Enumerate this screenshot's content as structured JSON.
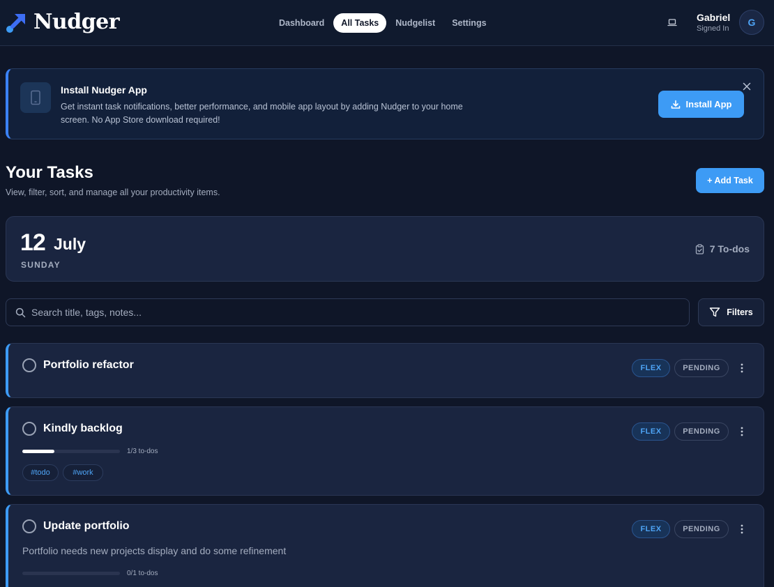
{
  "app": {
    "name": "Nudger"
  },
  "nav": [
    "Dashboard",
    "All Tasks",
    "Nudgelist",
    "Settings"
  ],
  "nav_active": "All Tasks",
  "user": {
    "name": "Gabriel",
    "status": "Signed In",
    "initial": "G"
  },
  "banner": {
    "title": "Install Nudger App",
    "description": "Get instant task notifications, better performance, and mobile app layout by adding Nudger to your home screen. No App Store download required!",
    "button": "Install App"
  },
  "page": {
    "title": "Your Tasks",
    "subtitle": "View, filter, sort, and manage all your productivity items.",
    "add_button": "+ Add Task"
  },
  "date": {
    "day": "12",
    "month": "July",
    "weekday": "SUNDAY",
    "todos": "7 To-dos"
  },
  "search": {
    "placeholder": "Search title, tags, notes..."
  },
  "filters_label": "Filters",
  "colors": {
    "accent": "#3d9bf5",
    "background": "#0f1628",
    "card": "#1a2540"
  },
  "tasks": [
    {
      "title": "Portfolio refactor",
      "type": "FLEX",
      "status": "PENDING"
    },
    {
      "title": "Kindly backlog",
      "type": "FLEX",
      "status": "PENDING",
      "progress_label": "1/3 to-dos",
      "progress": 0.33,
      "tags": [
        "#todo",
        "#work"
      ]
    },
    {
      "title": "Update portfolio",
      "type": "FLEX",
      "status": "PENDING",
      "notes": "Portfolio needs new projects display and do some refinement",
      "progress_label": "0/1 to-dos",
      "progress": 0
    }
  ]
}
